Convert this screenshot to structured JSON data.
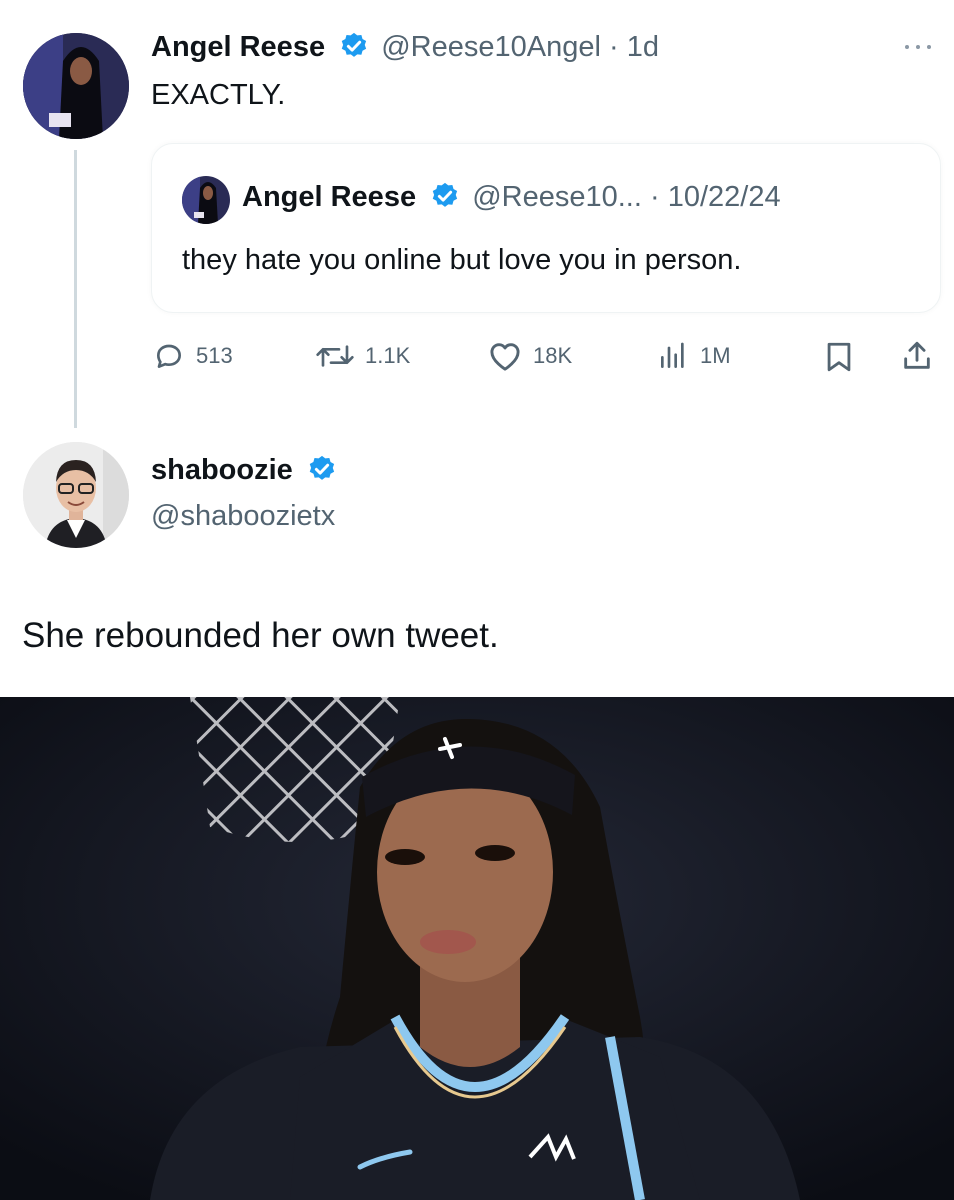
{
  "tweet": {
    "author_name": "Angel Reese",
    "author_handle": "@Reese10Angel",
    "separator": "·",
    "time": "1d",
    "text": "EXACTLY.",
    "more_icon": "more-dots-icon",
    "quoted": {
      "author_name": "Angel Reese",
      "author_handle": "@Reese10...",
      "separator": "·",
      "date": "10/22/24",
      "text": "they hate you online but love you in person."
    },
    "actions": {
      "replies": "513",
      "retweets": "1.1K",
      "likes": "18K",
      "views": "1M"
    }
  },
  "reply": {
    "author_name": "shaboozie",
    "author_handle": "@shaboozietx"
  },
  "caption": "She rebounded her own tweet.",
  "colors": {
    "verified": "#1d9bf0",
    "muted": "#536471",
    "text": "#0f1419",
    "photo_bg": "#10131c",
    "jersey": "#1a1d27",
    "jersey_trim": "#8ec8ef"
  }
}
